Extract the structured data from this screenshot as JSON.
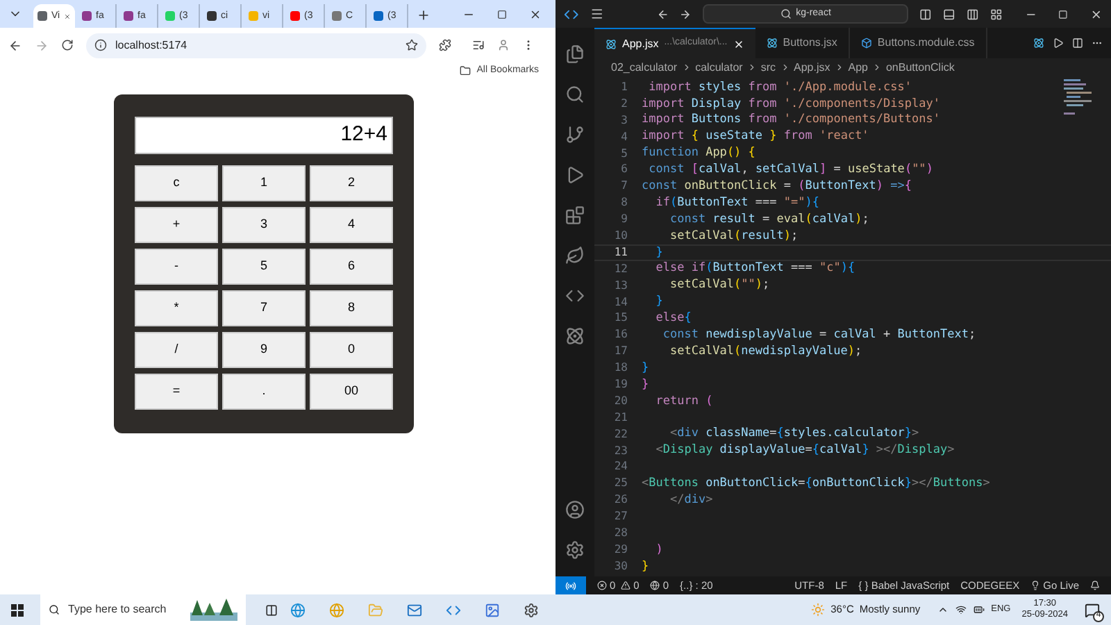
{
  "browser": {
    "tabs": [
      {
        "title": "Vi",
        "selected": true,
        "color": "#5f6368"
      },
      {
        "title": "fa",
        "selected": false,
        "color": "#8e3a8e"
      },
      {
        "title": "fa",
        "selected": false,
        "color": "#8e3a8e"
      },
      {
        "title": "(3",
        "selected": false,
        "color": "#25d366"
      },
      {
        "title": "ci",
        "selected": false,
        "color": "#333333"
      },
      {
        "title": "vi",
        "selected": false,
        "color": "#f4b400"
      },
      {
        "title": "(3",
        "selected": false,
        "color": "#ff0000"
      },
      {
        "title": "C",
        "selected": false,
        "color": "#777777"
      },
      {
        "title": "(3",
        "selected": false,
        "color": "#0a66c2"
      }
    ],
    "url": "localhost:5174",
    "bookmarks": "All Bookmarks",
    "calculator": {
      "display": "12+4",
      "buttons": [
        "c",
        "1",
        "2",
        "+",
        "3",
        "4",
        "-",
        "5",
        "6",
        "*",
        "7",
        "8",
        "/",
        "9",
        "0",
        "=",
        ".",
        "00"
      ]
    }
  },
  "editor": {
    "search": "kg-react",
    "tabs": [
      {
        "title": "App.jsx",
        "path": "...\\calculator\\...",
        "selected": true
      },
      {
        "title": "Buttons.jsx",
        "selected": false
      },
      {
        "title": "Buttons.module.css",
        "selected": false
      }
    ],
    "breadcrumb": [
      "02_calculator",
      "calculator",
      "src",
      "App.jsx",
      "App",
      "onButtonClick"
    ],
    "lines": [
      {
        "number": "1",
        "current": false,
        "tokens": [
          {
            "text": " import",
            "kind": "kw"
          },
          {
            "text": " styles ",
            "kind": "var"
          },
          {
            "text": "from",
            "kind": "kw"
          },
          {
            "text": " './App.module.css'",
            "kind": "str"
          }
        ]
      },
      {
        "number": "2",
        "current": false,
        "tokens": [
          {
            "text": "import",
            "kind": "kw"
          },
          {
            "text": " Display ",
            "kind": "var"
          },
          {
            "text": "from",
            "kind": "kw"
          },
          {
            "text": " './components/Display'",
            "kind": "str"
          }
        ]
      },
      {
        "number": "3",
        "current": false,
        "tokens": [
          {
            "text": "import",
            "kind": "kw"
          },
          {
            "text": " Buttons ",
            "kind": "var"
          },
          {
            "text": "from",
            "kind": "kw"
          },
          {
            "text": " './components/Buttons'",
            "kind": "str"
          }
        ]
      },
      {
        "number": "4",
        "current": false,
        "tokens": [
          {
            "text": "import ",
            "kind": "kw"
          },
          {
            "text": "{",
            "kind": "br1"
          },
          {
            "text": " useState ",
            "kind": "var"
          },
          {
            "text": "}",
            "kind": "br1"
          },
          {
            "text": " from",
            "kind": "kw"
          },
          {
            "text": " 'react'",
            "kind": "str"
          }
        ]
      },
      {
        "number": "5",
        "current": false,
        "tokens": [
          {
            "text": "function",
            "kind": "decl"
          },
          {
            "text": " App",
            "kind": "fn"
          },
          {
            "text": "()",
            "kind": "br1"
          },
          {
            "text": " {",
            "kind": "br1"
          }
        ]
      },
      {
        "number": "6",
        "current": false,
        "tokens": [
          {
            "text": " const",
            "kind": "decl"
          },
          {
            "text": " [",
            "kind": "br2"
          },
          {
            "text": "calVal",
            "kind": "var"
          },
          {
            "text": ", ",
            "kind": "p"
          },
          {
            "text": "setCalVal",
            "kind": "var"
          },
          {
            "text": "]",
            "kind": "br2"
          },
          {
            "text": " = ",
            "kind": "p"
          },
          {
            "text": "useState",
            "kind": "fn"
          },
          {
            "text": "(",
            "kind": "br2"
          },
          {
            "text": "\"\"",
            "kind": "str"
          },
          {
            "text": ")",
            "kind": "br2"
          }
        ]
      },
      {
        "number": "7",
        "current": false,
        "tokens": [
          {
            "text": "const",
            "kind": "decl"
          },
          {
            "text": " onButtonClick",
            "kind": "fn"
          },
          {
            "text": " = ",
            "kind": "p"
          },
          {
            "text": "(",
            "kind": "br2"
          },
          {
            "text": "ButtonText",
            "kind": "var"
          },
          {
            "text": ") ",
            "kind": "br2"
          },
          {
            "text": "=>",
            "kind": "decl"
          },
          {
            "text": "{",
            "kind": "br2"
          }
        ]
      },
      {
        "number": "8",
        "current": false,
        "tokens": [
          {
            "text": "  if",
            "kind": "kw"
          },
          {
            "text": "(",
            "kind": "br3"
          },
          {
            "text": "ButtonText",
            "kind": "var"
          },
          {
            "text": " === ",
            "kind": "p"
          },
          {
            "text": "\"=\"",
            "kind": "str"
          },
          {
            "text": "){",
            "kind": "br3"
          }
        ]
      },
      {
        "number": "9",
        "current": false,
        "tokens": [
          {
            "text": "    const",
            "kind": "decl"
          },
          {
            "text": " result",
            "kind": "var"
          },
          {
            "text": " = ",
            "kind": "p"
          },
          {
            "text": "eval",
            "kind": "fn"
          },
          {
            "text": "(",
            "kind": "br1"
          },
          {
            "text": "calVal",
            "kind": "var"
          },
          {
            "text": ")",
            "kind": "br1"
          },
          {
            "text": ";",
            "kind": "p"
          }
        ]
      },
      {
        "number": "10",
        "current": false,
        "tokens": [
          {
            "text": "    setCalVal",
            "kind": "fn"
          },
          {
            "text": "(",
            "kind": "br1"
          },
          {
            "text": "result",
            "kind": "var"
          },
          {
            "text": ")",
            "kind": "br1"
          },
          {
            "text": ";",
            "kind": "p"
          }
        ]
      },
      {
        "number": "11",
        "current": true,
        "tokens": [
          {
            "text": "  }",
            "kind": "br3"
          }
        ]
      },
      {
        "number": "12",
        "current": false,
        "tokens": [
          {
            "text": "  else if",
            "kind": "kw"
          },
          {
            "text": "(",
            "kind": "br3"
          },
          {
            "text": "ButtonText",
            "kind": "var"
          },
          {
            "text": " === ",
            "kind": "p"
          },
          {
            "text": "\"c\"",
            "kind": "str"
          },
          {
            "text": "){",
            "kind": "br3"
          }
        ]
      },
      {
        "number": "13",
        "current": false,
        "tokens": [
          {
            "text": "    setCalVal",
            "kind": "fn"
          },
          {
            "text": "(",
            "kind": "br1"
          },
          {
            "text": "\"\"",
            "kind": "str"
          },
          {
            "text": ")",
            "kind": "br1"
          },
          {
            "text": ";",
            "kind": "p"
          }
        ]
      },
      {
        "number": "14",
        "current": false,
        "tokens": [
          {
            "text": "  }",
            "kind": "br3"
          }
        ]
      },
      {
        "number": "15",
        "current": false,
        "tokens": [
          {
            "text": "  else",
            "kind": "kw"
          },
          {
            "text": "{",
            "kind": "br3"
          }
        ]
      },
      {
        "number": "16",
        "current": false,
        "tokens": [
          {
            "text": "   const",
            "kind": "decl"
          },
          {
            "text": " newdisplayValue",
            "kind": "var"
          },
          {
            "text": " = ",
            "kind": "p"
          },
          {
            "text": "calVal",
            "kind": "var"
          },
          {
            "text": " + ",
            "kind": "p"
          },
          {
            "text": "ButtonText",
            "kind": "var"
          },
          {
            "text": ";",
            "kind": "p"
          }
        ]
      },
      {
        "number": "17",
        "current": false,
        "tokens": [
          {
            "text": "    setCalVal",
            "kind": "fn"
          },
          {
            "text": "(",
            "kind": "br1"
          },
          {
            "text": "newdisplayValue",
            "kind": "var"
          },
          {
            "text": ")",
            "kind": "br1"
          },
          {
            "text": ";",
            "kind": "p"
          }
        ]
      },
      {
        "number": "18",
        "current": false,
        "tokens": [
          {
            "text": "}",
            "kind": "br3"
          }
        ]
      },
      {
        "number": "19",
        "current": false,
        "tokens": [
          {
            "text": "}",
            "kind": "br2"
          }
        ]
      },
      {
        "number": "20",
        "current": false,
        "tokens": [
          {
            "text": "  return",
            "kind": "kw"
          },
          {
            "text": " (",
            "kind": "br2"
          }
        ]
      },
      {
        "number": "21",
        "current": false
      },
      {
        "number": "22",
        "current": false,
        "tokens": [
          {
            "text": "    <",
            "kind": "ang"
          },
          {
            "text": "div",
            "kind": "decl"
          },
          {
            "text": " className",
            "kind": "var"
          },
          {
            "text": "=",
            "kind": "p"
          },
          {
            "text": "{",
            "kind": "br3"
          },
          {
            "text": "styles.calculator",
            "kind": "var"
          },
          {
            "text": "}",
            "kind": "br3"
          },
          {
            "text": ">",
            "kind": "ang"
          }
        ]
      },
      {
        "number": "23",
        "current": false,
        "tokens": [
          {
            "text": "  <",
            "kind": "ang"
          },
          {
            "text": "Display",
            "kind": "tag"
          },
          {
            "text": " displayValue",
            "kind": "var"
          },
          {
            "text": "=",
            "kind": "p"
          },
          {
            "text": "{",
            "kind": "br3"
          },
          {
            "text": "calVal",
            "kind": "var"
          },
          {
            "text": "}",
            "kind": "br3"
          },
          {
            "text": " ></",
            "kind": "ang"
          },
          {
            "text": "Display",
            "kind": "tag"
          },
          {
            "text": ">",
            "kind": "ang"
          }
        ]
      },
      {
        "number": "24",
        "current": false
      },
      {
        "number": "25",
        "current": false,
        "tokens": [
          {
            "text": "<",
            "kind": "ang"
          },
          {
            "text": "Buttons",
            "kind": "tag"
          },
          {
            "text": " onButtonClick",
            "kind": "var"
          },
          {
            "text": "=",
            "kind": "p"
          },
          {
            "text": "{",
            "kind": "br3"
          },
          {
            "text": "onButtonClick",
            "kind": "var"
          },
          {
            "text": "}",
            "kind": "br3"
          },
          {
            "text": "></",
            "kind": "ang"
          },
          {
            "text": "Buttons",
            "kind": "tag"
          },
          {
            "text": ">",
            "kind": "ang"
          }
        ]
      },
      {
        "number": "26",
        "current": false,
        "tokens": [
          {
            "text": "    </",
            "kind": "ang"
          },
          {
            "text": "div",
            "kind": "decl"
          },
          {
            "text": ">",
            "kind": "ang"
          }
        ]
      },
      {
        "number": "27",
        "current": false
      },
      {
        "number": "28",
        "current": false
      },
      {
        "number": "29",
        "current": false,
        "tokens": [
          {
            "text": "  )",
            "kind": "br2"
          }
        ]
      },
      {
        "number": "30",
        "current": false,
        "tokens": [
          {
            "text": "}",
            "kind": "br1"
          }
        ]
      }
    ],
    "status": {
      "errors": "0",
      "warnings": "0",
      "ports": "0",
      "position": "{..} : 20",
      "encoding": "UTF-8",
      "eol": "LF",
      "language": "{ } Babel JavaScript",
      "codegeex": "CODEGEEX",
      "golive": "Go Live"
    }
  },
  "taskbar": {
    "search": "Type here to search",
    "temperature": "36°C",
    "weather": "Mostly sunny",
    "language": "ENG",
    "time": "17:30",
    "date": "25-09-2024",
    "notifications": "4"
  }
}
